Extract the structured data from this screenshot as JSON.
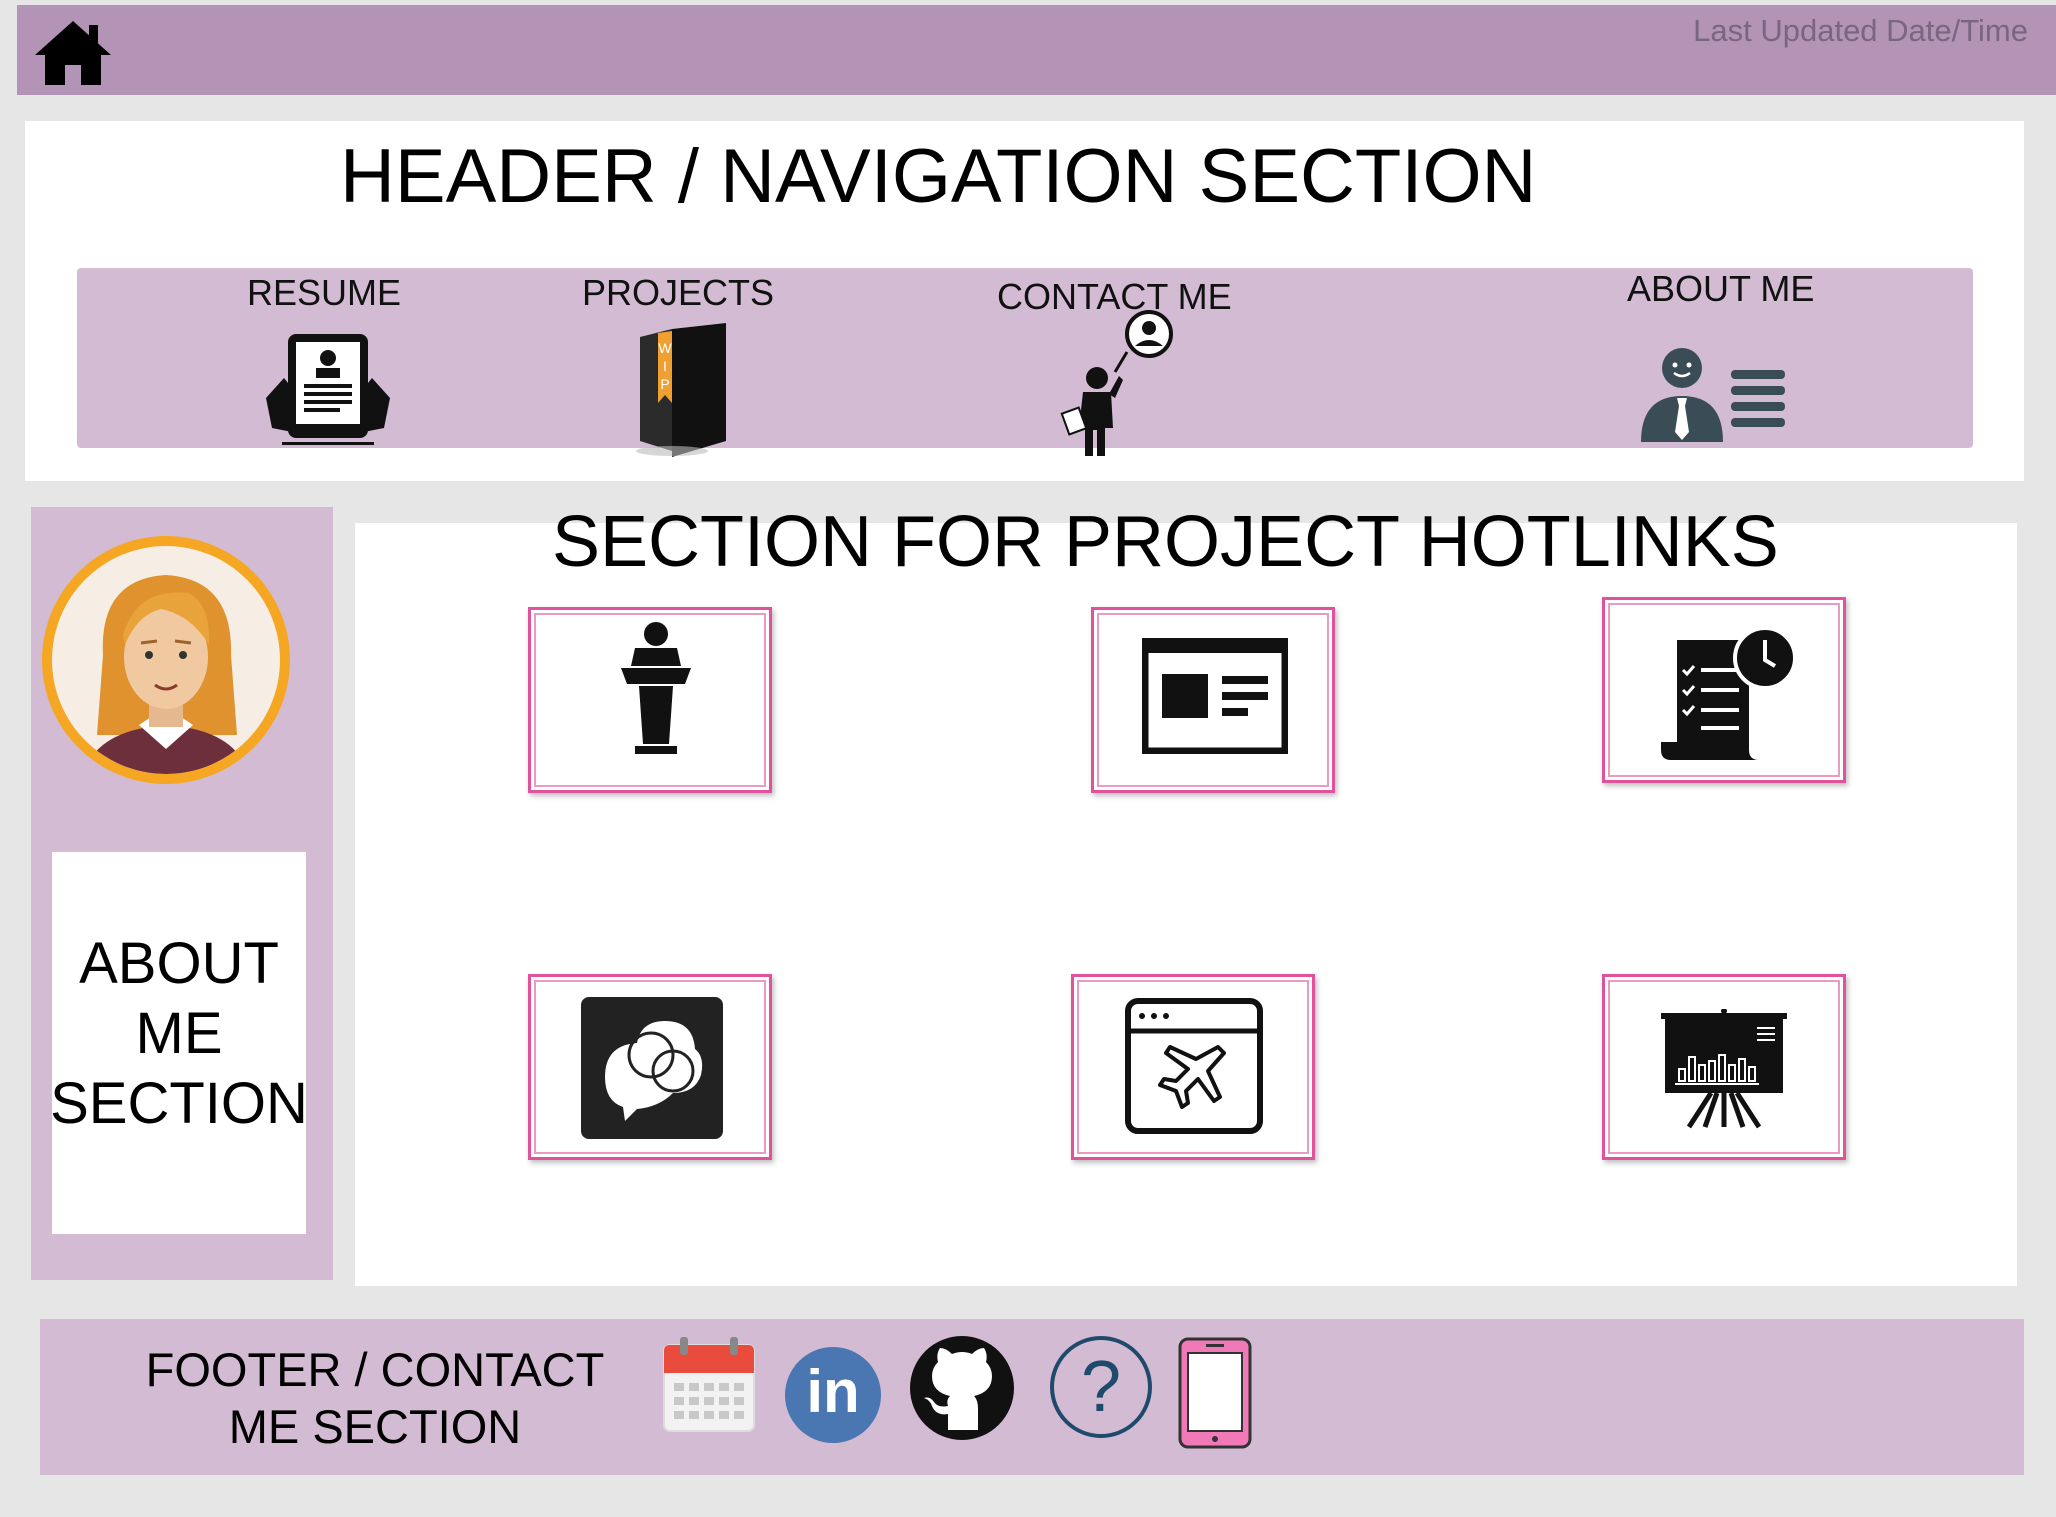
{
  "topbar": {
    "last_updated": "Last Updated Date/Time"
  },
  "header": {
    "title": "HEADER / NAVIGATION SECTION",
    "nav": [
      {
        "label": "RESUME",
        "icon": "resume-tablet-icon"
      },
      {
        "label": "PROJECTS",
        "icon": "wip-folder-icon"
      },
      {
        "label": "CONTACT ME",
        "icon": "person-phone-icon"
      },
      {
        "label": "ABOUT ME",
        "icon": "profile-card-icon"
      }
    ]
  },
  "sidebar": {
    "about_line1": "ABOUT",
    "about_line2": "ME",
    "about_line3": "SECTION"
  },
  "hotlinks": {
    "title": "SECTION FOR PROJECT HOTLINKS",
    "tiles": [
      {
        "icon": "podium-icon"
      },
      {
        "icon": "news-article-icon"
      },
      {
        "icon": "checklist-clock-icon"
      },
      {
        "icon": "chat-bubbles-icon"
      },
      {
        "icon": "browser-plane-icon"
      },
      {
        "icon": "presentation-chart-icon"
      }
    ]
  },
  "footer": {
    "title_line1": "FOOTER / CONTACT",
    "title_line2": "ME SECTION",
    "icons": [
      "calendar-icon",
      "linkedin-icon",
      "github-icon",
      "help-icon",
      "mobile-phone-icon"
    ],
    "linkedin_text": "in",
    "help_text": "?"
  },
  "colors": {
    "topbar": "#b393b6",
    "band": "#d3bcd3",
    "tile_border": "#e0529c",
    "avatar_ring": "#f5a623"
  }
}
